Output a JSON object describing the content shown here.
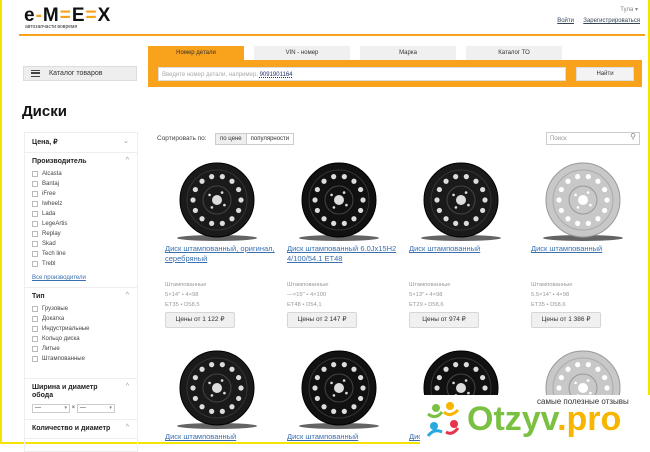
{
  "header": {
    "logo": "e-M-E-X",
    "tagline": "автозапчасти вовремя",
    "city": "Тула ▾",
    "login": "Войти",
    "register": "Зарегистрироваться"
  },
  "tabs": [
    "Номер детали",
    "VIN - номер",
    "Марка",
    "Каталог ТО"
  ],
  "search": {
    "placeholder": "Введите номер детали, например,",
    "example": "9091901164",
    "button": "Найти"
  },
  "catalog_button": "Каталог товаров",
  "page_title": "Диски",
  "filters": {
    "price": "Цена, ₽",
    "maker": {
      "title": "Производитель",
      "items": [
        "Alcasta",
        "Bantaj",
        "iFree",
        "Iwheelz",
        "Lada",
        "LegeArtis",
        "Replay",
        "Skad",
        "Tech line",
        "Trebl"
      ],
      "all": "Все производители"
    },
    "type": {
      "title": "Тип",
      "items": [
        "Грузовые",
        "Докатка",
        "Индустриальные",
        "Кольцо диска",
        "Литые",
        "Штампованные"
      ]
    },
    "rim": {
      "title": "Ширина и диаметр обода",
      "sel1": "—",
      "x": "×",
      "sel2": "—"
    },
    "bolts": "Количество и диаметр"
  },
  "sort": {
    "label": "Сортировать по:",
    "options": [
      "по цене",
      "популярности"
    ]
  },
  "product_search_placeholder": "Поиск",
  "products": [
    {
      "title": "Диск штампованный, оригинал, серебряный",
      "type": "Штампованные",
      "size": "5×14\" • 4×98",
      "et": "ET35 • D58,5",
      "price": "Цены от 1 122 ₽",
      "color": "#1a1a1a"
    },
    {
      "title": "Диск штампованный 6.0Jx15H2 4/100/54.1 ET48",
      "type": "Штампованные",
      "size": "—×15\" • 4×100",
      "et": "ET48 • D54,1",
      "price": "Цены от 2 147 ₽",
      "color": "#111"
    },
    {
      "title": "Диск штампованный",
      "type": "Штампованные",
      "size": "5×13\" • 4×98",
      "et": "ET29 • D58,6",
      "price": "Цены от 974 ₽",
      "color": "#1a1a1a"
    },
    {
      "title": "Диск штампованный",
      "type": "Штампованные",
      "size": "5.5×14\" • 4×98",
      "et": "ET35 • D58,6",
      "price": "Цены от 1 386 ₽",
      "color": "#c8c8c8"
    },
    {
      "title": "Диск штампованный",
      "color": "#1a1a1a"
    },
    {
      "title": "Диск штампованный",
      "color": "#111"
    },
    {
      "title": "Диск штампованный",
      "color": "#111"
    },
    {
      "title": "",
      "color": "#c8c8c8"
    }
  ],
  "watermark": {
    "slogan": "самые полезные отзывы",
    "brand": "Otzyv",
    ".pro": ".pro"
  }
}
